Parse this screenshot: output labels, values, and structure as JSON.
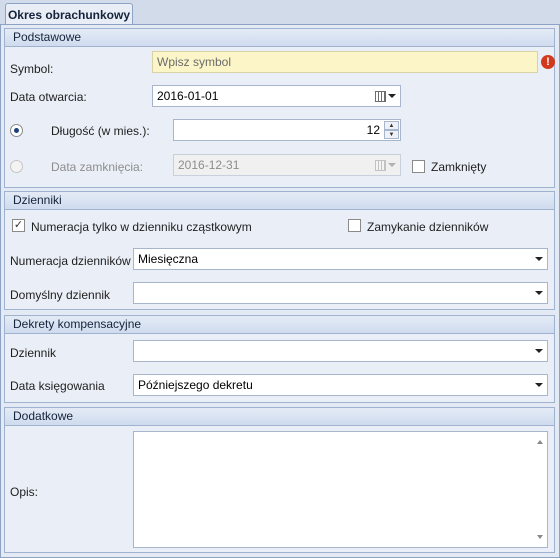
{
  "tab": {
    "label": "Okres obrachunkowy"
  },
  "podstawowe": {
    "header": "Podstawowe",
    "symbol_label": "Symbol:",
    "symbol_placeholder": "Wpisz symbol",
    "data_otwarcia_label": "Data otwarcia:",
    "data_otwarcia_value": "2016-01-01",
    "dlugosc_label": "Długość (w mies.):",
    "dlugosc_value": "12",
    "data_zamkniecia_label": "Data zamknięcia:",
    "data_zamkniecia_value": "2016-12-31",
    "zamkniety_label": "Zamknięty"
  },
  "dzienniki": {
    "header": "Dzienniki",
    "numeracja_czastkowym_label": "Numeracja tylko w dzienniku cząstkowym",
    "zamykanie_label": "Zamykanie dzienników",
    "numeracja_label": "Numeracja dzienników",
    "numeracja_value": "Miesięczna",
    "domyslny_label": "Domyślny dziennik",
    "domyslny_value": ""
  },
  "dekrety": {
    "header": "Dekrety kompensacyjne",
    "dziennik_label": "Dziennik",
    "dziennik_value": "",
    "data_ksiegowania_label": "Data księgowania",
    "data_ksiegowania_value": "Późniejszego dekretu"
  },
  "dodatkowe": {
    "header": "Dodatkowe",
    "opis_label": "Opis:",
    "opis_value": ""
  },
  "icons": {
    "error": "exclamation-icon",
    "calendar": "calendar-icon",
    "dropdown": "chevron-down-icon"
  }
}
